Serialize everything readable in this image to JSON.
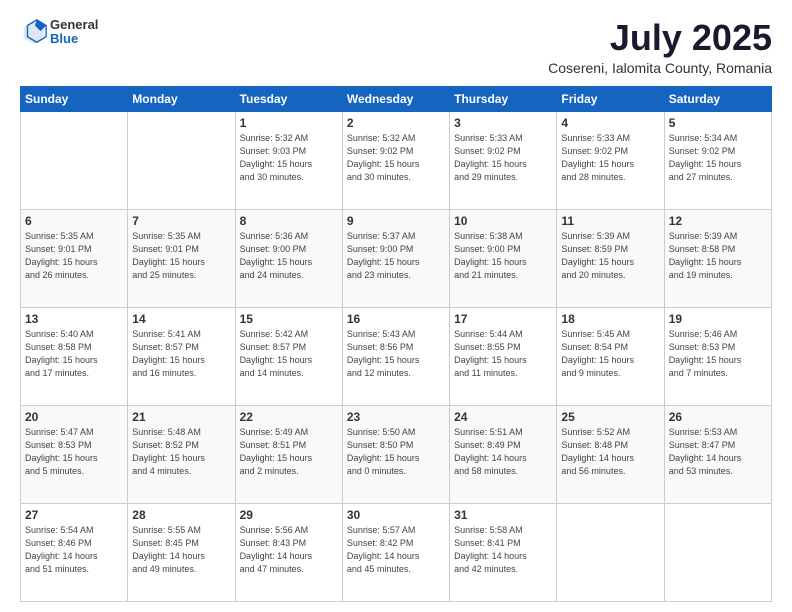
{
  "logo": {
    "general": "General",
    "blue": "Blue"
  },
  "title": "July 2025",
  "location": "Cosereni, Ialomita County, Romania",
  "weekdays": [
    "Sunday",
    "Monday",
    "Tuesday",
    "Wednesday",
    "Thursday",
    "Friday",
    "Saturday"
  ],
  "weeks": [
    [
      {
        "day": "",
        "info": ""
      },
      {
        "day": "",
        "info": ""
      },
      {
        "day": "1",
        "info": "Sunrise: 5:32 AM\nSunset: 9:03 PM\nDaylight: 15 hours\nand 30 minutes."
      },
      {
        "day": "2",
        "info": "Sunrise: 5:32 AM\nSunset: 9:02 PM\nDaylight: 15 hours\nand 30 minutes."
      },
      {
        "day": "3",
        "info": "Sunrise: 5:33 AM\nSunset: 9:02 PM\nDaylight: 15 hours\nand 29 minutes."
      },
      {
        "day": "4",
        "info": "Sunrise: 5:33 AM\nSunset: 9:02 PM\nDaylight: 15 hours\nand 28 minutes."
      },
      {
        "day": "5",
        "info": "Sunrise: 5:34 AM\nSunset: 9:02 PM\nDaylight: 15 hours\nand 27 minutes."
      }
    ],
    [
      {
        "day": "6",
        "info": "Sunrise: 5:35 AM\nSunset: 9:01 PM\nDaylight: 15 hours\nand 26 minutes."
      },
      {
        "day": "7",
        "info": "Sunrise: 5:35 AM\nSunset: 9:01 PM\nDaylight: 15 hours\nand 25 minutes."
      },
      {
        "day": "8",
        "info": "Sunrise: 5:36 AM\nSunset: 9:00 PM\nDaylight: 15 hours\nand 24 minutes."
      },
      {
        "day": "9",
        "info": "Sunrise: 5:37 AM\nSunset: 9:00 PM\nDaylight: 15 hours\nand 23 minutes."
      },
      {
        "day": "10",
        "info": "Sunrise: 5:38 AM\nSunset: 9:00 PM\nDaylight: 15 hours\nand 21 minutes."
      },
      {
        "day": "11",
        "info": "Sunrise: 5:39 AM\nSunset: 8:59 PM\nDaylight: 15 hours\nand 20 minutes."
      },
      {
        "day": "12",
        "info": "Sunrise: 5:39 AM\nSunset: 8:58 PM\nDaylight: 15 hours\nand 19 minutes."
      }
    ],
    [
      {
        "day": "13",
        "info": "Sunrise: 5:40 AM\nSunset: 8:58 PM\nDaylight: 15 hours\nand 17 minutes."
      },
      {
        "day": "14",
        "info": "Sunrise: 5:41 AM\nSunset: 8:57 PM\nDaylight: 15 hours\nand 16 minutes."
      },
      {
        "day": "15",
        "info": "Sunrise: 5:42 AM\nSunset: 8:57 PM\nDaylight: 15 hours\nand 14 minutes."
      },
      {
        "day": "16",
        "info": "Sunrise: 5:43 AM\nSunset: 8:56 PM\nDaylight: 15 hours\nand 12 minutes."
      },
      {
        "day": "17",
        "info": "Sunrise: 5:44 AM\nSunset: 8:55 PM\nDaylight: 15 hours\nand 11 minutes."
      },
      {
        "day": "18",
        "info": "Sunrise: 5:45 AM\nSunset: 8:54 PM\nDaylight: 15 hours\nand 9 minutes."
      },
      {
        "day": "19",
        "info": "Sunrise: 5:46 AM\nSunset: 8:53 PM\nDaylight: 15 hours\nand 7 minutes."
      }
    ],
    [
      {
        "day": "20",
        "info": "Sunrise: 5:47 AM\nSunset: 8:53 PM\nDaylight: 15 hours\nand 5 minutes."
      },
      {
        "day": "21",
        "info": "Sunrise: 5:48 AM\nSunset: 8:52 PM\nDaylight: 15 hours\nand 4 minutes."
      },
      {
        "day": "22",
        "info": "Sunrise: 5:49 AM\nSunset: 8:51 PM\nDaylight: 15 hours\nand 2 minutes."
      },
      {
        "day": "23",
        "info": "Sunrise: 5:50 AM\nSunset: 8:50 PM\nDaylight: 15 hours\nand 0 minutes."
      },
      {
        "day": "24",
        "info": "Sunrise: 5:51 AM\nSunset: 8:49 PM\nDaylight: 14 hours\nand 58 minutes."
      },
      {
        "day": "25",
        "info": "Sunrise: 5:52 AM\nSunset: 8:48 PM\nDaylight: 14 hours\nand 56 minutes."
      },
      {
        "day": "26",
        "info": "Sunrise: 5:53 AM\nSunset: 8:47 PM\nDaylight: 14 hours\nand 53 minutes."
      }
    ],
    [
      {
        "day": "27",
        "info": "Sunrise: 5:54 AM\nSunset: 8:46 PM\nDaylight: 14 hours\nand 51 minutes."
      },
      {
        "day": "28",
        "info": "Sunrise: 5:55 AM\nSunset: 8:45 PM\nDaylight: 14 hours\nand 49 minutes."
      },
      {
        "day": "29",
        "info": "Sunrise: 5:56 AM\nSunset: 8:43 PM\nDaylight: 14 hours\nand 47 minutes."
      },
      {
        "day": "30",
        "info": "Sunrise: 5:57 AM\nSunset: 8:42 PM\nDaylight: 14 hours\nand 45 minutes."
      },
      {
        "day": "31",
        "info": "Sunrise: 5:58 AM\nSunset: 8:41 PM\nDaylight: 14 hours\nand 42 minutes."
      },
      {
        "day": "",
        "info": ""
      },
      {
        "day": "",
        "info": ""
      }
    ]
  ]
}
